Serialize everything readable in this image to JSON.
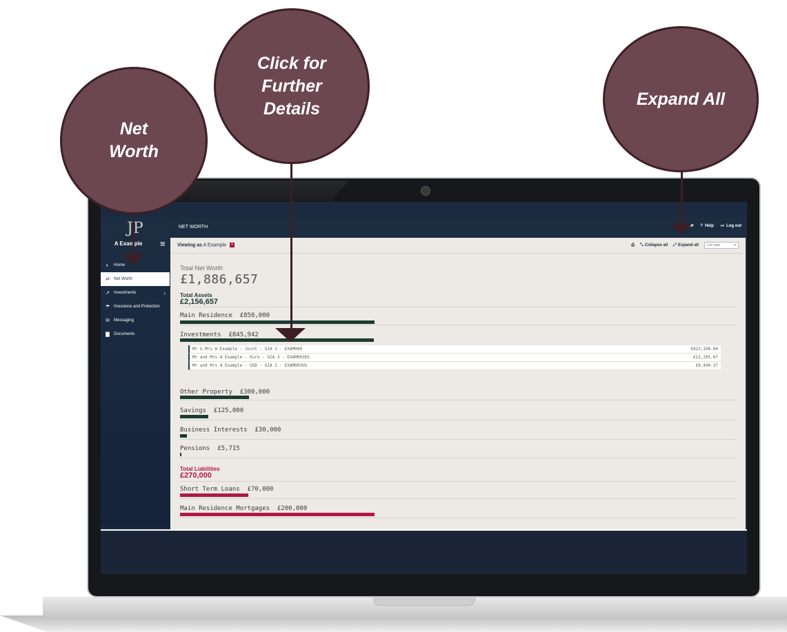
{
  "app": {
    "page_title": "NET WORTH",
    "user_name": "A Example",
    "logo_mark": "JP"
  },
  "nav": [
    {
      "label": "Home",
      "icon": "dashboard-icon"
    },
    {
      "label": "Net Worth",
      "icon": "exchange-icon"
    },
    {
      "label": "Investments",
      "icon": "chart-line-icon"
    },
    {
      "label": "Insurance and Protection",
      "icon": "umbrella-icon"
    },
    {
      "label": "Messaging",
      "icon": "envelope-icon"
    },
    {
      "label": "Documents",
      "icon": "document-icon"
    }
  ],
  "top_actions": {
    "help": "Help",
    "logout": "Log out"
  },
  "view_bar": {
    "viewing_prefix": "Viewing as",
    "viewing_name": "A Example",
    "collapse_all": "Collapse all",
    "expand_all": "Expand all",
    "view_select": "List view"
  },
  "summary": {
    "net_worth_label": "Total Net Worth",
    "net_worth_value": "£1,886,657",
    "assets_label": "Total Assets",
    "assets_value": "£2,156,657",
    "liabilities_label": "Total Liabilities",
    "liabilities_value": "£270,000"
  },
  "assets": [
    {
      "name": "Main Residence",
      "value": "£850,000",
      "share": 1.0
    },
    {
      "name": "Investments",
      "value": "£845,942",
      "share": 0.995
    },
    {
      "name": "Other Property",
      "value": "£300,000",
      "share": 0.353
    },
    {
      "name": "Savings",
      "value": "£125,000",
      "share": 0.147
    },
    {
      "name": "Business Interests",
      "value": "£30,000",
      "share": 0.035
    },
    {
      "name": "Pensions",
      "value": "£5,715",
      "share": 0.007
    }
  ],
  "investment_accounts": [
    {
      "name": "Mr & Mrs A Example - Joint - GIA 1 - EXAM004",
      "value": "£823,198.04"
    },
    {
      "name": "Mr and Mrs A Example - Euro - GIA 3 - EXAM003EU",
      "value": "£13,295.07"
    },
    {
      "name": "Mr and Mrs A Example - USD - GIA 2 - EXAM003US",
      "value": "£9,449.37"
    }
  ],
  "liabilities": [
    {
      "name": "Short Term Loans",
      "value": "£70,000",
      "share": 0.35
    },
    {
      "name": "Main Residence Mortgages",
      "value": "£200,000",
      "share": 1.0
    }
  ],
  "callouts": {
    "net_worth": "Net Worth",
    "further_details": "Click for Further Details",
    "expand_all": "Expand All"
  },
  "colors": {
    "callout_fill": "#6d4750",
    "asset_bar": "#1c3a34",
    "liability_bar": "#b01846",
    "nav_bg": "#1c2d42"
  }
}
